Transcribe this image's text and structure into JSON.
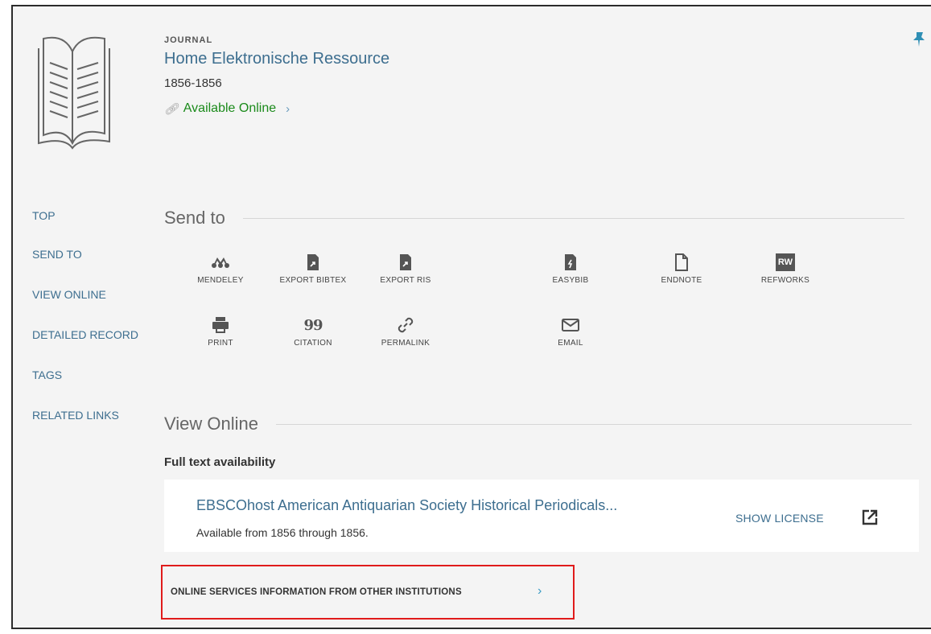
{
  "record": {
    "type": "JOURNAL",
    "title": "Home Elektronische Ressource",
    "date": "1856-1856",
    "availability": "Available Online"
  },
  "nav": {
    "items": [
      "TOP",
      "SEND TO",
      "VIEW ONLINE",
      "DETAILED RECORD",
      "TAGS",
      "RELATED LINKS"
    ]
  },
  "send_to": {
    "heading": "Send to",
    "tools": [
      {
        "label": "MENDELEY",
        "icon": "mendeley-icon"
      },
      {
        "label": "EXPORT BIBTEX",
        "icon": "export-bibtex-icon"
      },
      {
        "label": "EXPORT RIS",
        "icon": "export-ris-icon"
      },
      {
        "label": "EASYBIB",
        "icon": "easybib-icon"
      },
      {
        "label": "ENDNOTE",
        "icon": "endnote-icon"
      },
      {
        "label": "REFWORKS",
        "icon": "refworks-icon",
        "badge": "RW"
      },
      {
        "label": "PRINT",
        "icon": "print-icon"
      },
      {
        "label": "CITATION",
        "icon": "citation-icon",
        "glyph": "99"
      },
      {
        "label": "PERMALINK",
        "icon": "permalink-icon"
      },
      {
        "label": "EMAIL",
        "icon": "email-icon"
      }
    ]
  },
  "view_online": {
    "heading": "View Online",
    "full_text_label": "Full text availability",
    "service": {
      "title": "EBSCOhost American Antiquarian Society Historical Periodicals...",
      "range": "Available from 1856 through 1856.",
      "license_label": "SHOW LICENSE"
    },
    "other_institutions": "ONLINE SERVICES INFORMATION FROM OTHER INSTITUTIONS"
  },
  "colors": {
    "link": "#3d6e8f",
    "available": "#1a8a1a",
    "highlight": "#e01b1b"
  }
}
